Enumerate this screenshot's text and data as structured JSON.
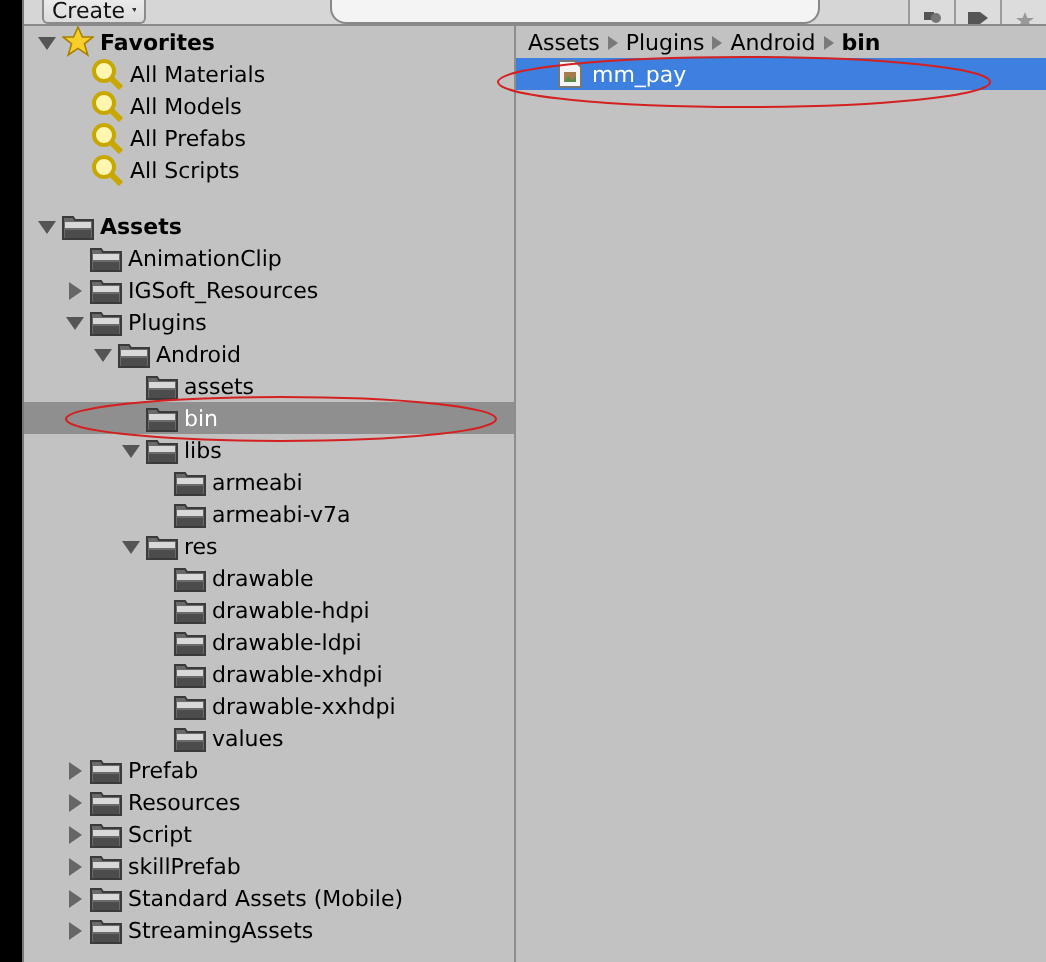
{
  "toolbar": {
    "create_button": "Create"
  },
  "favorites": {
    "label": "Favorites",
    "expanded": true,
    "items": [
      {
        "label": "All Materials",
        "selected": false
      },
      {
        "label": "All Models",
        "selected": false
      },
      {
        "label": "All Prefabs",
        "selected": false
      },
      {
        "label": "All Scripts",
        "selected": false
      }
    ]
  },
  "assets": {
    "label": "Assets",
    "expanded": true,
    "children": [
      {
        "label": "AnimationClip",
        "selected": false
      },
      {
        "label": "IGSoft_Resources",
        "selected": false,
        "expanded": false
      },
      {
        "label": "Plugins",
        "selected": false,
        "expanded": true,
        "children": [
          {
            "label": "Android",
            "selected": false,
            "expanded": true,
            "children": [
              {
                "label": "assets",
                "selected": false
              },
              {
                "label": "bin",
                "selected": true,
                "circled": true
              },
              {
                "label": "libs",
                "selected": false,
                "expanded": true,
                "children": [
                  {
                    "label": "armeabi",
                    "selected": false
                  },
                  {
                    "label": "armeabi-v7a",
                    "selected": false
                  }
                ]
              },
              {
                "label": "res",
                "selected": false,
                "expanded": true,
                "children": [
                  {
                    "label": "drawable",
                    "selected": false
                  },
                  {
                    "label": "drawable-hdpi",
                    "selected": false
                  },
                  {
                    "label": "drawable-ldpi",
                    "selected": false
                  },
                  {
                    "label": "drawable-xhdpi",
                    "selected": false
                  },
                  {
                    "label": "drawable-xxhdpi",
                    "selected": false
                  },
                  {
                    "label": "values",
                    "selected": false
                  }
                ]
              }
            ]
          }
        ]
      },
      {
        "label": "Prefab",
        "selected": false,
        "expanded": false
      },
      {
        "label": "Resources",
        "selected": false,
        "expanded": false
      },
      {
        "label": "Script",
        "selected": false,
        "expanded": false
      },
      {
        "label": "skillPrefab",
        "selected": false,
        "expanded": false
      },
      {
        "label": "Standard Assets (Mobile)",
        "selected": false,
        "expanded": false
      },
      {
        "label": "StreamingAssets",
        "selected": false,
        "expanded": false
      }
    ]
  },
  "breadcrumb": [
    {
      "label": "Assets",
      "current": false
    },
    {
      "label": "Plugins",
      "current": false
    },
    {
      "label": "Android",
      "current": false
    },
    {
      "label": "bin",
      "current": true
    }
  ],
  "files": [
    {
      "label": "mm_pay",
      "selected": true,
      "circled": true
    }
  ]
}
